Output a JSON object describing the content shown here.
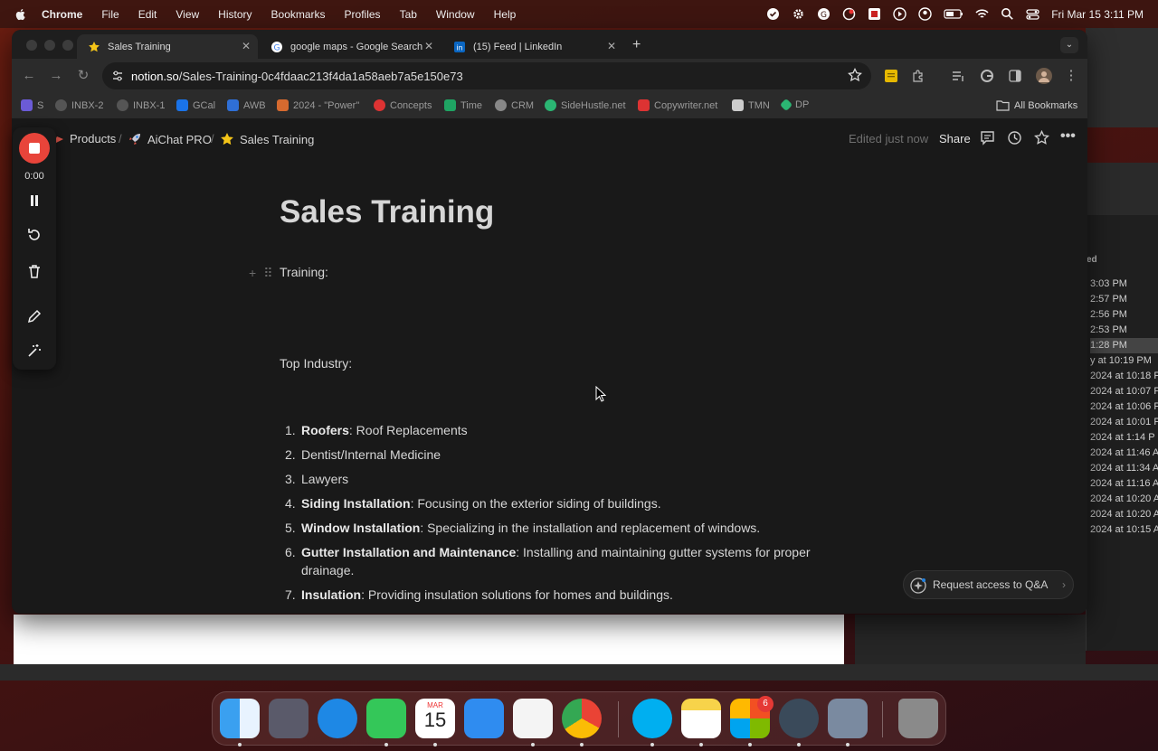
{
  "menubar": {
    "app": "Chrome",
    "items": [
      "File",
      "Edit",
      "View",
      "History",
      "Bookmarks",
      "Profiles",
      "Tab",
      "Window",
      "Help"
    ],
    "datetime": "Fri Mar 15  3:11 PM"
  },
  "tabs": [
    {
      "title": "Sales Training",
      "active": true
    },
    {
      "title": "google maps - Google Search",
      "active": false
    },
    {
      "title": "(15) Feed | LinkedIn",
      "active": false
    }
  ],
  "address": {
    "host": "notion.so",
    "path": "/Sales-Training-0c4fdaac213f4da1a58aeb7a5e150e73"
  },
  "bookmarks": [
    {
      "label": "S",
      "color": "#6b5bd6"
    },
    {
      "label": "INBX-2",
      "color": "#555"
    },
    {
      "label": "INBX-1",
      "color": "#555"
    },
    {
      "label": "GCal",
      "color": "#1a73e8"
    },
    {
      "label": "AWB",
      "color": "#2f6fd6"
    },
    {
      "label": "2024 - \"Power\"",
      "color": "#d66a2f"
    },
    {
      "label": "Concepts",
      "color": "#d33"
    },
    {
      "label": "Time",
      "color": "#1fa463"
    },
    {
      "label": "CRM",
      "color": "#888"
    },
    {
      "label": "SideHustle.net",
      "color": "#2bb673"
    },
    {
      "label": "Copywriter.net",
      "color": "#d33"
    },
    {
      "label": "TMN",
      "color": "#ccc"
    },
    {
      "label": "DP",
      "color": "#2bb673"
    }
  ],
  "all_bookmarks": "All Bookmarks",
  "breadcrumb": {
    "items": [
      "Products",
      "AiChat PRO",
      "Sales Training"
    ],
    "edited": "Edited just now",
    "share": "Share"
  },
  "document": {
    "title": "Sales Training",
    "training_label": "Training:",
    "top_industry_label": "Top Industry:",
    "list": [
      {
        "num": "1.",
        "bold": "Roofers",
        "rest": ": Roof Replacements"
      },
      {
        "num": "2.",
        "bold": "",
        "rest": "Dentist/Internal Medicine"
      },
      {
        "num": "3.",
        "bold": "",
        "rest": "Lawyers"
      },
      {
        "num": "4.",
        "bold": "Siding Installation",
        "rest": ": Focusing on the exterior siding of buildings."
      },
      {
        "num": "5.",
        "bold": "Window Installation",
        "rest": ": Specializing in the installation and replacement of windows."
      },
      {
        "num": "6.",
        "bold": "Gutter Installation and Maintenance",
        "rest": ": Installing and maintaining gutter systems for proper drainage."
      },
      {
        "num": "7.",
        "bold": "Insulation",
        "rest": ": Providing insulation solutions for homes and buildings."
      }
    ]
  },
  "qa_button": "Request access to Q&A",
  "recorder": {
    "timer": "0:00"
  },
  "background_window": {
    "header": "ed",
    "times": [
      "3:03 PM",
      "2:57 PM",
      "2:56 PM",
      "2:53 PM",
      "1:28 PM",
      "y at 10:19 PM",
      "2024 at 10:18 P",
      "2024 at 10:07 P",
      "2024 at 10:06 P",
      "2024 at 10:01 P",
      "2024 at 1:14 P",
      "2024 at 11:46 A",
      "2024 at 11:34 A",
      "2024 at 11:16 A",
      "2024 at 10:20 A",
      "2024 at 10:20 A",
      "2024 at 10:15 A"
    ]
  },
  "dock": {
    "calendar_month": "MAR",
    "calendar_day": "15",
    "mail_badge": "6"
  }
}
